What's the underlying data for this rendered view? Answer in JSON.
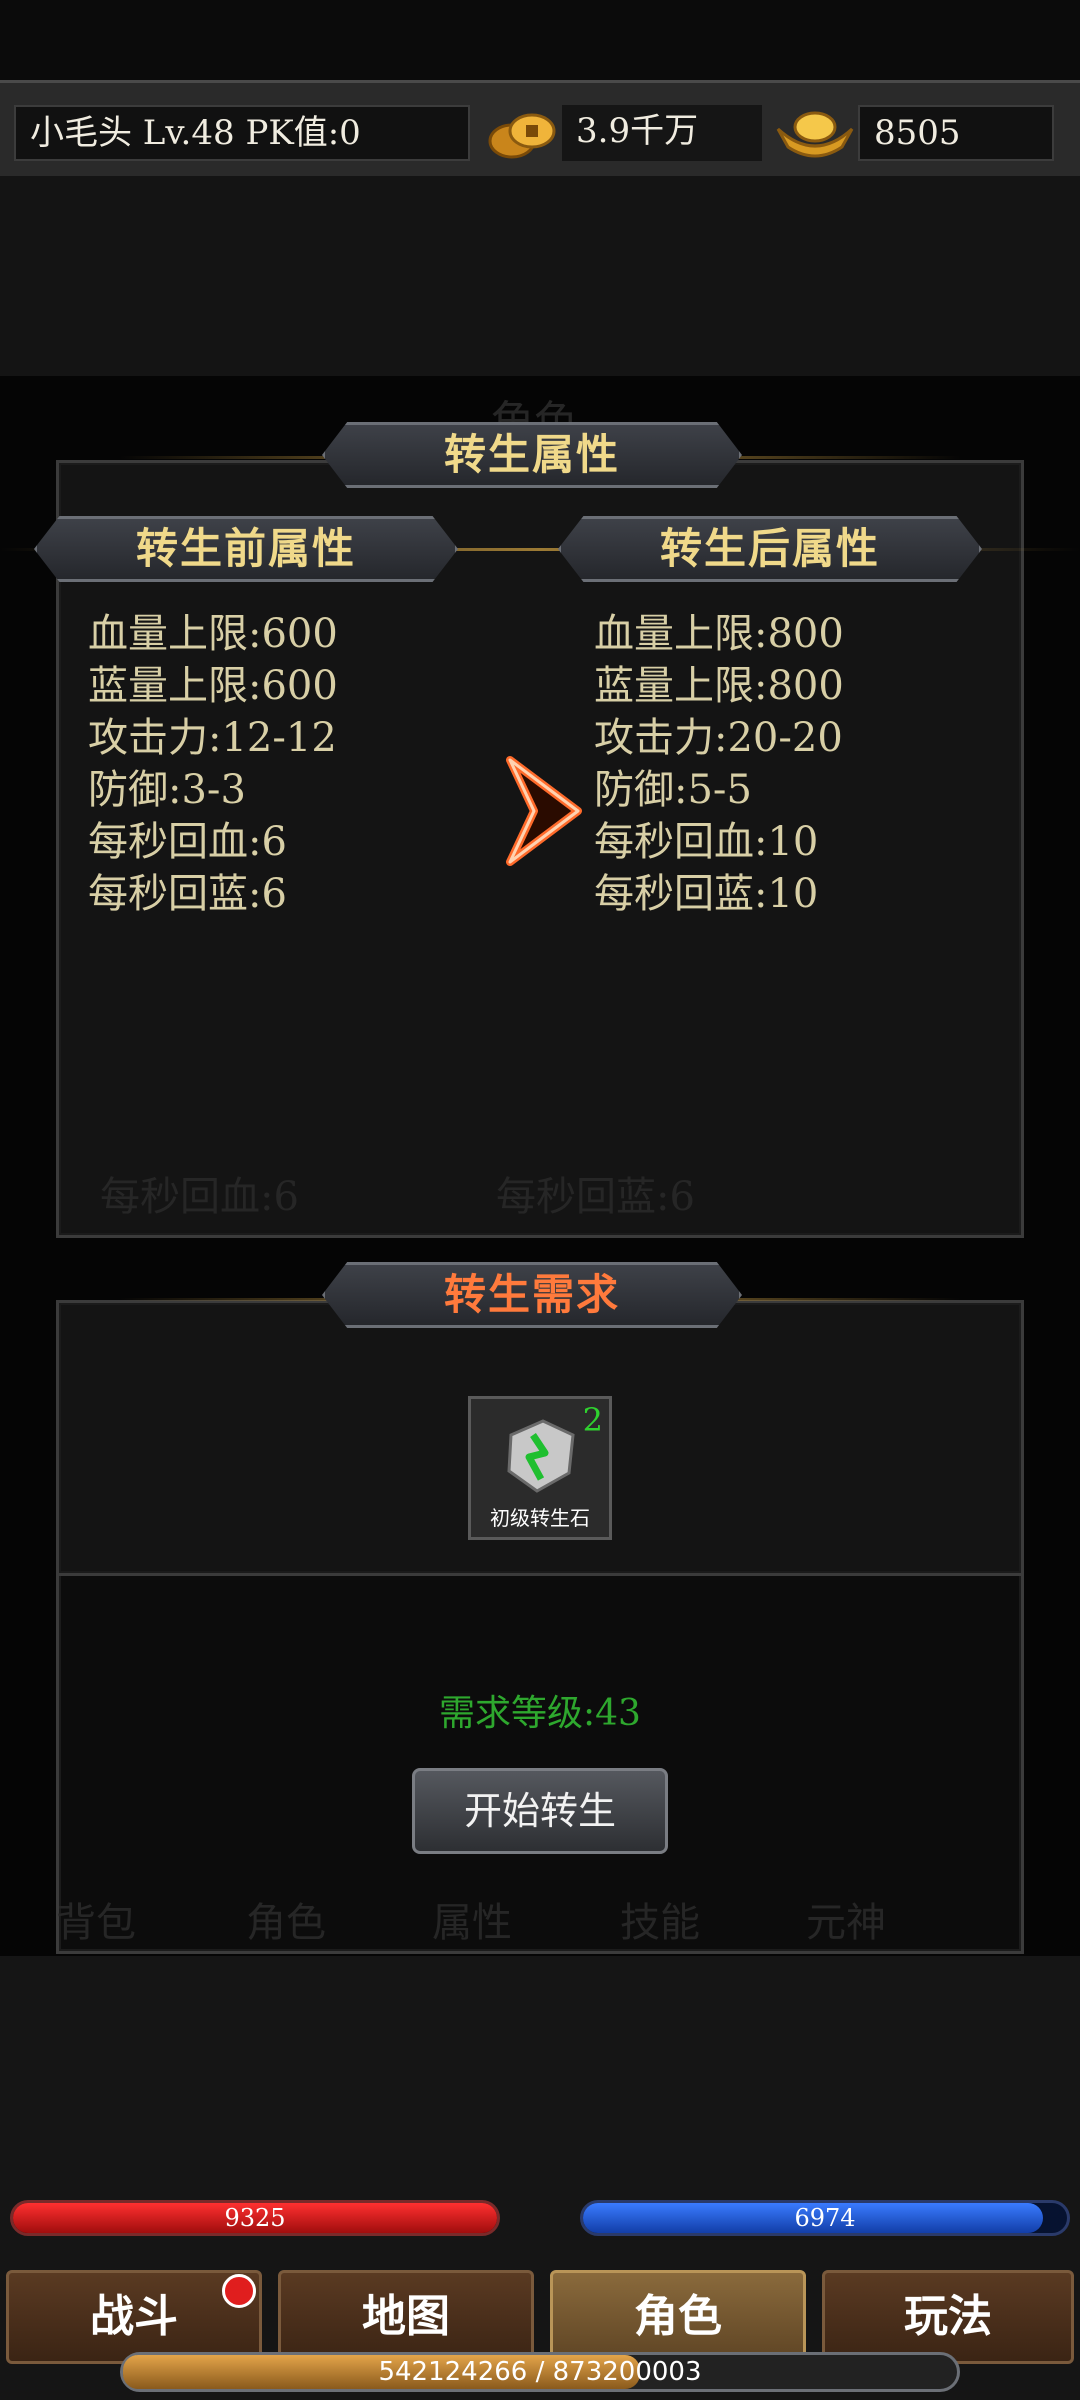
{
  "header": {
    "player": "小毛头  Lv.48 PK值:0",
    "gold_icon": "gold-coins-icon",
    "gold": "3.9千万",
    "ingot_icon": "gold-ingot-icon",
    "ingots": "8505"
  },
  "panel": {
    "ghost_title": "角色",
    "title": "转生属性",
    "before_title": "转生前属性",
    "after_title": "转生后属性",
    "before": [
      "血量上限:600",
      "蓝量上限:600",
      "攻击力:12-12",
      "防御:3-3",
      "每秒回血:6",
      "每秒回蓝:6"
    ],
    "after": [
      "血量上限:800",
      "蓝量上限:800",
      "攻击力:20-20",
      "防御:5-5",
      "每秒回血:10",
      "每秒回蓝:10"
    ],
    "ghost_stats": [
      "每秒回血:6",
      "每秒回蓝:6"
    ],
    "req_title": "转生需求",
    "item": {
      "name": "初级转生石",
      "count": "2",
      "icon": "rebirth-stone-icon"
    },
    "req_level": "需求等级:43",
    "start_button": "开始转生"
  },
  "ghost_tabs": [
    "背包",
    "角色",
    "属性",
    "技能",
    "元神"
  ],
  "bars": {
    "hp": "9325",
    "hp_fill": 1.0,
    "mp": "6974",
    "mp_fill": 0.95
  },
  "nav": [
    "战斗",
    "地图",
    "角色",
    "玩法"
  ],
  "active_nav": "角色",
  "exp": "542124266 / 873200003",
  "exp_fill": 0.62,
  "colors": {
    "gold_text": "#f0d98a",
    "red_title": "#ff7a3c",
    "green": "#2ea82e",
    "hp": "#c01a1a",
    "mp": "#1d4fd0"
  }
}
